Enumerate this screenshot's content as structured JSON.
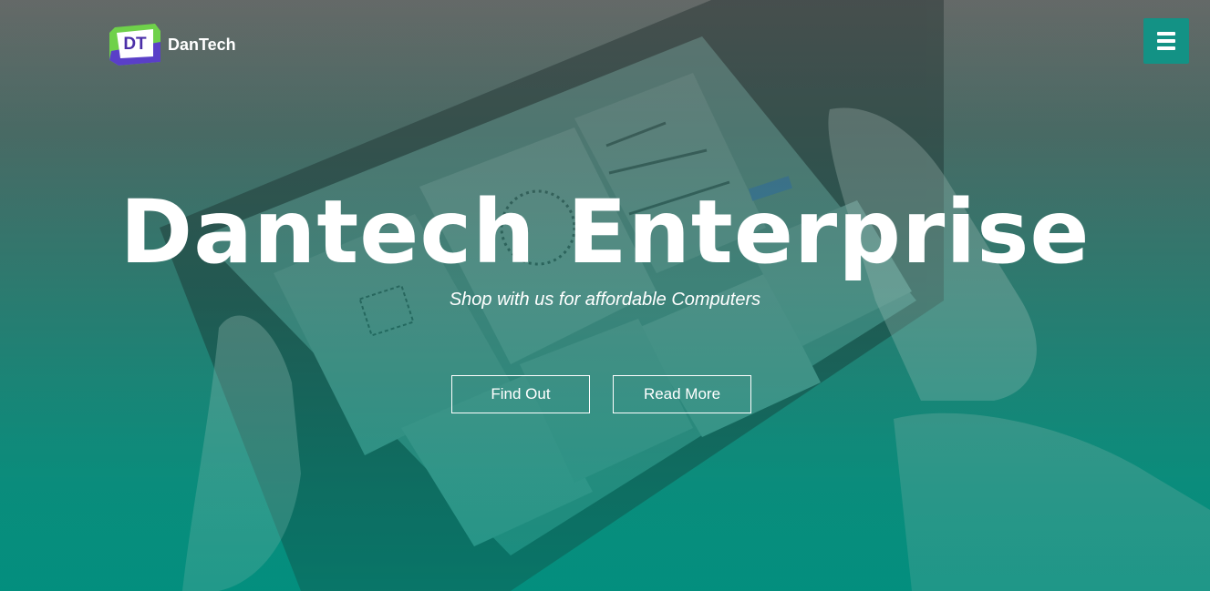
{
  "brand": {
    "logo_initials": "DT",
    "name": "DanTech"
  },
  "nav": {
    "menu_icon": "hamburger-menu-icon"
  },
  "hero": {
    "title": "Dantech Enterprise",
    "tagline": "Shop with us for affordable Computers",
    "buttons": [
      {
        "label": "Find Out"
      },
      {
        "label": "Read More"
      }
    ]
  },
  "colors": {
    "accent": "#139285",
    "hero_bottom": "#079283",
    "text": "#ffffff",
    "logo_purple": "#4b2fa8",
    "logo_green": "#6fd14a"
  }
}
